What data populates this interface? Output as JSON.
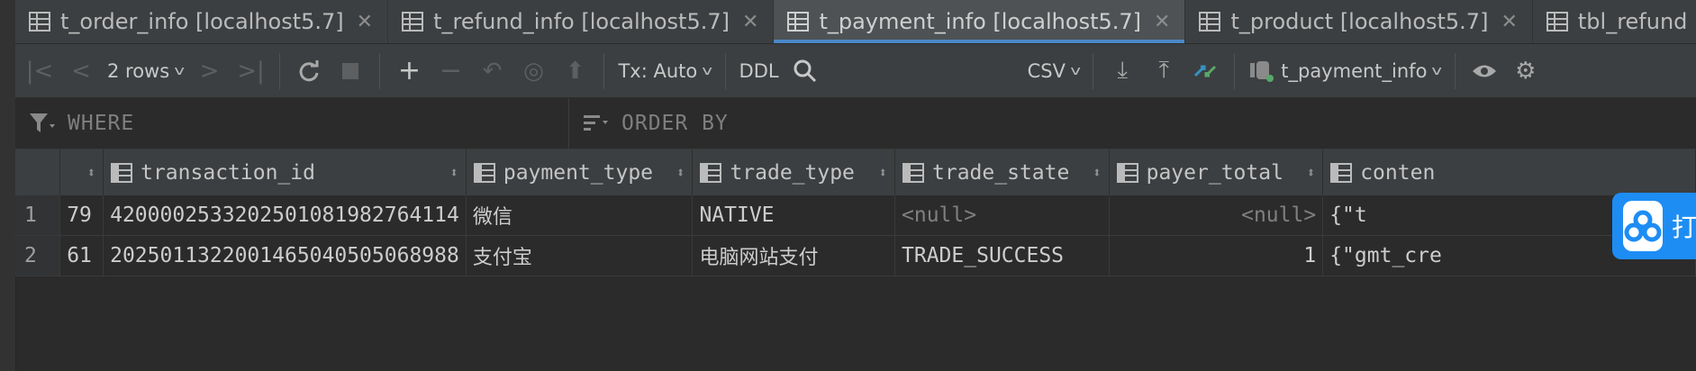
{
  "tabs": [
    {
      "label": "t_order_info [localhost5.7]",
      "active": false,
      "closable": true
    },
    {
      "label": "t_refund_info [localhost5.7]",
      "active": false,
      "closable": true
    },
    {
      "label": "t_payment_info [localhost5.7]",
      "active": true,
      "closable": true
    },
    {
      "label": "t_product [localhost5.7]",
      "active": false,
      "closable": true
    },
    {
      "label": "tbl_refund [lo",
      "active": false,
      "closable": false
    }
  ],
  "toolbar": {
    "rows_label": "2 rows",
    "tx_label": "Tx: Auto",
    "ddl_label": "DDL",
    "export_format": "CSV",
    "datasource_label": "t_payment_info"
  },
  "filters": {
    "where_label": "WHERE",
    "orderby_label": "ORDER BY"
  },
  "grid": {
    "columns": [
      "",
      "transaction_id",
      "payment_type",
      "trade_type",
      "trade_state",
      "payer_total",
      "conten"
    ],
    "rows": [
      {
        "num": "1",
        "id": "79",
        "transaction_id": "4200002533202501081982764114",
        "payment_type": "微信",
        "trade_type": "NATIVE",
        "trade_state": "<null>",
        "payer_total": "<null>",
        "content": "{\"t"
      },
      {
        "num": "2",
        "id": "61",
        "transaction_id": "2025011322001465040505068988",
        "payment_type": "支付宝",
        "trade_type": "电脑网站支付",
        "trade_state": "TRADE_SUCCESS",
        "payer_total": "1",
        "content": "{\"gmt_cre"
      }
    ]
  },
  "floating_widget": {
    "text": "打",
    "color": "#1d8df4"
  },
  "colors": {
    "active_tab_underline": "#4a88c7",
    "background": "#2b2b2b",
    "accent_green": "#59a869",
    "accent_blue": "#3592c4"
  }
}
